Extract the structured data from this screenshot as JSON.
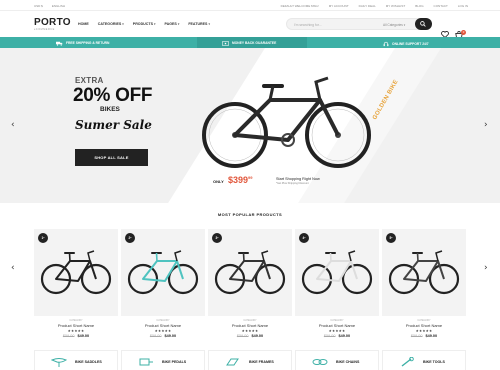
{
  "topbar": {
    "left": [
      "USD $",
      "ENGLISH"
    ],
    "right": [
      "DEFAULT WELCOME MSG!",
      "MY ACCOUNT",
      "DAILY DEAL",
      "MY WISHLIST",
      "BLOG",
      "CONTACT",
      "LOG IN"
    ]
  },
  "header": {
    "logo": "PORTO",
    "logo_sub": "eCOMMERCE",
    "nav": [
      "HOME",
      "CATEGORIES",
      "PRODUCTS",
      "PAGES",
      "FEATURES"
    ],
    "search_placeholder": "I'm searching for...",
    "search_category": "All Categories",
    "cart_count": "0"
  },
  "promo": {
    "items": [
      "FREE SHIPPING & RETURN",
      "MONEY BACK GUARANTEE",
      "ONLINE SUPPORT 24/7"
    ]
  },
  "hero": {
    "extra": "EXTRA",
    "headline": "20% OFF",
    "subject": "BIKES",
    "script": "Sumer Sale",
    "cta": "SHOP ALL SALE",
    "only_label": "ONLY",
    "price_main": "$399",
    "price_cents": "99",
    "ship_title": "Start Shopping Right Now",
    "ship_sub": "*Get Plus Shipping Discount",
    "brand": "GOLDEN BIKE"
  },
  "popular": {
    "title": "MOST POPULAR PRODUCTS",
    "products": [
      {
        "rank": "1º",
        "category": "CATEGORY",
        "name": "Product Short Name",
        "stars": "★★★★★",
        "old_price": "$59.00",
        "price": "$49.00",
        "frame": "#222222"
      },
      {
        "rank": "2º",
        "category": "CATEGORY",
        "name": "Product Short Name",
        "stars": "★★★★★",
        "old_price": "$59.00",
        "price": "$49.00",
        "frame": "#4fc3c0"
      },
      {
        "rank": "3º",
        "category": "CATEGORY",
        "name": "Product Short Name",
        "stars": "★★★★★",
        "old_price": "$59.00",
        "price": "$49.00",
        "frame": "#333333"
      },
      {
        "rank": "4º",
        "category": "CATEGORY",
        "name": "Product Short Name",
        "stars": "★★★★★",
        "old_price": "$59.00",
        "price": "$49.00",
        "frame": "#dddddd"
      },
      {
        "rank": "5º",
        "category": "CATEGORY",
        "name": "Product Short Name",
        "stars": "★★★★★",
        "old_price": "$59.00",
        "price": "$49.00",
        "frame": "#444444"
      }
    ]
  },
  "categories": [
    {
      "label": "BIKE SADDLES",
      "icon": "saddle-icon"
    },
    {
      "label": "BIKE PEDALS",
      "icon": "pedal-icon"
    },
    {
      "label": "BIKE FRAMES",
      "icon": "frame-icon"
    },
    {
      "label": "BIKE CHAINS",
      "icon": "chain-icon"
    },
    {
      "label": "BIKE TOOLS",
      "icon": "tool-icon"
    }
  ],
  "colors": {
    "accent": "#3db0a6",
    "price": "#e1563b",
    "dark": "#222222",
    "brand": "#e7a33a"
  }
}
